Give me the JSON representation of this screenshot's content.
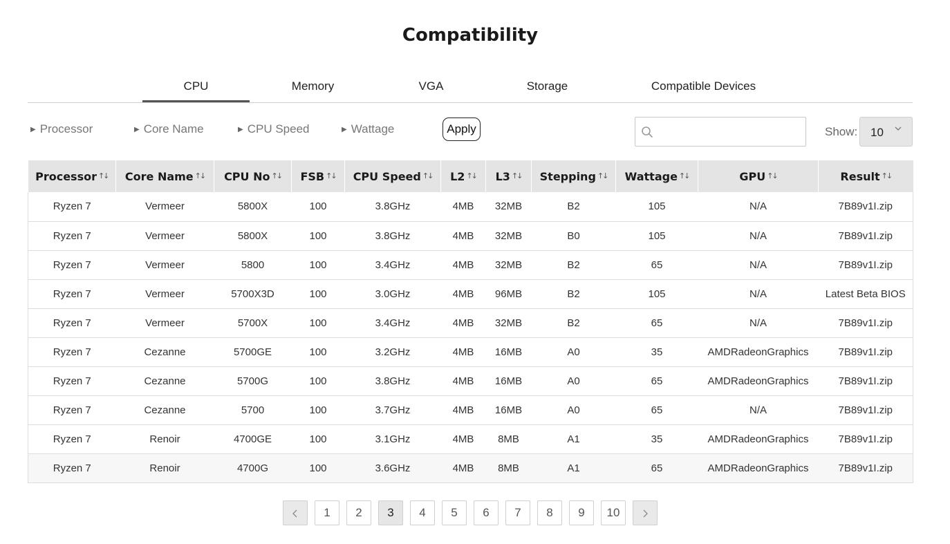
{
  "page": {
    "title": "Compatibility"
  },
  "tabs": [
    {
      "label": "CPU",
      "active": true
    },
    {
      "label": "Memory",
      "active": false
    },
    {
      "label": "VGA",
      "active": false
    },
    {
      "label": "Storage",
      "active": false
    },
    {
      "label": "Compatible Devices",
      "active": false
    }
  ],
  "filters": {
    "items": [
      "Processor",
      "Core Name",
      "CPU Speed",
      "Wattage"
    ],
    "apply_label": "Apply"
  },
  "search": {
    "placeholder": "",
    "value": ""
  },
  "show": {
    "label": "Show:",
    "value": "10"
  },
  "table": {
    "columns": [
      "Processor",
      "Core Name",
      "CPU No",
      "FSB",
      "CPU Speed",
      "L2",
      "L3",
      "Stepping",
      "Wattage",
      "GPU",
      "Result"
    ],
    "rows": [
      [
        "Ryzen 7",
        "Vermeer",
        "5800X",
        "100",
        "3.8GHz",
        "4MB",
        "32MB",
        "B2",
        "105",
        "N/A",
        "7B89v1I.zip"
      ],
      [
        "Ryzen 7",
        "Vermeer",
        "5800X",
        "100",
        "3.8GHz",
        "4MB",
        "32MB",
        "B0",
        "105",
        "N/A",
        "7B89v1I.zip"
      ],
      [
        "Ryzen 7",
        "Vermeer",
        "5800",
        "100",
        "3.4GHz",
        "4MB",
        "32MB",
        "B2",
        "65",
        "N/A",
        "7B89v1I.zip"
      ],
      [
        "Ryzen 7",
        "Vermeer",
        "5700X3D",
        "100",
        "3.0GHz",
        "4MB",
        "96MB",
        "B2",
        "105",
        "N/A",
        "Latest Beta BIOS"
      ],
      [
        "Ryzen 7",
        "Vermeer",
        "5700X",
        "100",
        "3.4GHz",
        "4MB",
        "32MB",
        "B2",
        "65",
        "N/A",
        "7B89v1I.zip"
      ],
      [
        "Ryzen 7",
        "Cezanne",
        "5700GE",
        "100",
        "3.2GHz",
        "4MB",
        "16MB",
        "A0",
        "35",
        "AMDRadeonGraphics",
        "7B89v1I.zip"
      ],
      [
        "Ryzen 7",
        "Cezanne",
        "5700G",
        "100",
        "3.8GHz",
        "4MB",
        "16MB",
        "A0",
        "65",
        "AMDRadeonGraphics",
        "7B89v1I.zip"
      ],
      [
        "Ryzen 7",
        "Cezanne",
        "5700",
        "100",
        "3.7GHz",
        "4MB",
        "16MB",
        "A0",
        "65",
        "N/A",
        "7B89v1I.zip"
      ],
      [
        "Ryzen 7",
        "Renoir",
        "4700GE",
        "100",
        "3.1GHz",
        "4MB",
        "8MB",
        "A1",
        "35",
        "AMDRadeonGraphics",
        "7B89v1I.zip"
      ],
      [
        "Ryzen 7",
        "Renoir",
        "4700G",
        "100",
        "3.6GHz",
        "4MB",
        "8MB",
        "A1",
        "65",
        "AMDRadeonGraphics",
        "7B89v1I.zip"
      ]
    ]
  },
  "pagination": {
    "pages": [
      "1",
      "2",
      "3",
      "4",
      "5",
      "6",
      "7",
      "8",
      "9",
      "10"
    ],
    "current": "3"
  },
  "icons": {
    "search": "search-icon",
    "select": "chevron-down-icon",
    "sort": "sort-icon",
    "prev": "chevron-left-icon",
    "next": "chevron-right-icon"
  }
}
